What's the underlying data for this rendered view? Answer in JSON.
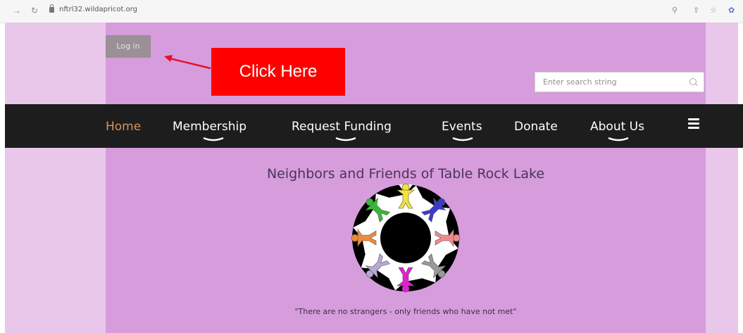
{
  "browser": {
    "url": "nftrl32.wildapricot.org",
    "back_icon": "back-arrow-icon",
    "reload_icon": "reload-icon",
    "lock_icon": "lock-icon",
    "zoom_icon": "zoom-icon",
    "share_icon": "share-icon",
    "bookmark_icon": "star-icon",
    "extension_icon": "extension-icon"
  },
  "header": {
    "login_label": "Log in",
    "search_placeholder": "Enter search string"
  },
  "annotation": {
    "callout_text": "Click Here",
    "arrow_color": "#e8102a"
  },
  "nav": {
    "items": [
      {
        "label": "Home",
        "active": true
      },
      {
        "label": "Membership",
        "has_submenu": true
      },
      {
        "label": "Request Funding",
        "has_submenu": true
      },
      {
        "label": "Events",
        "has_submenu": true
      },
      {
        "label": "Donate"
      },
      {
        "label": "About Us",
        "has_submenu": true
      }
    ],
    "menu_icon": "hamburger-icon"
  },
  "content": {
    "title": "Neighbors and Friends of Table Rock Lake",
    "tagline": "\"There are no strangers - only friends who have not met\""
  },
  "colors": {
    "page_band": "#e8c7ea",
    "panel": "#d69cdc",
    "menu_bar": "#1d1d1d",
    "active_nav": "#d4945e",
    "callout": "#ff0000",
    "login_button": "#9a9096",
    "logo_figures": [
      "#f2e23a",
      "#3a3ad0",
      "#f08a8a",
      "#9a9a9a",
      "#e020d0",
      "#b8a8d8",
      "#f08a3a",
      "#38b838"
    ]
  }
}
